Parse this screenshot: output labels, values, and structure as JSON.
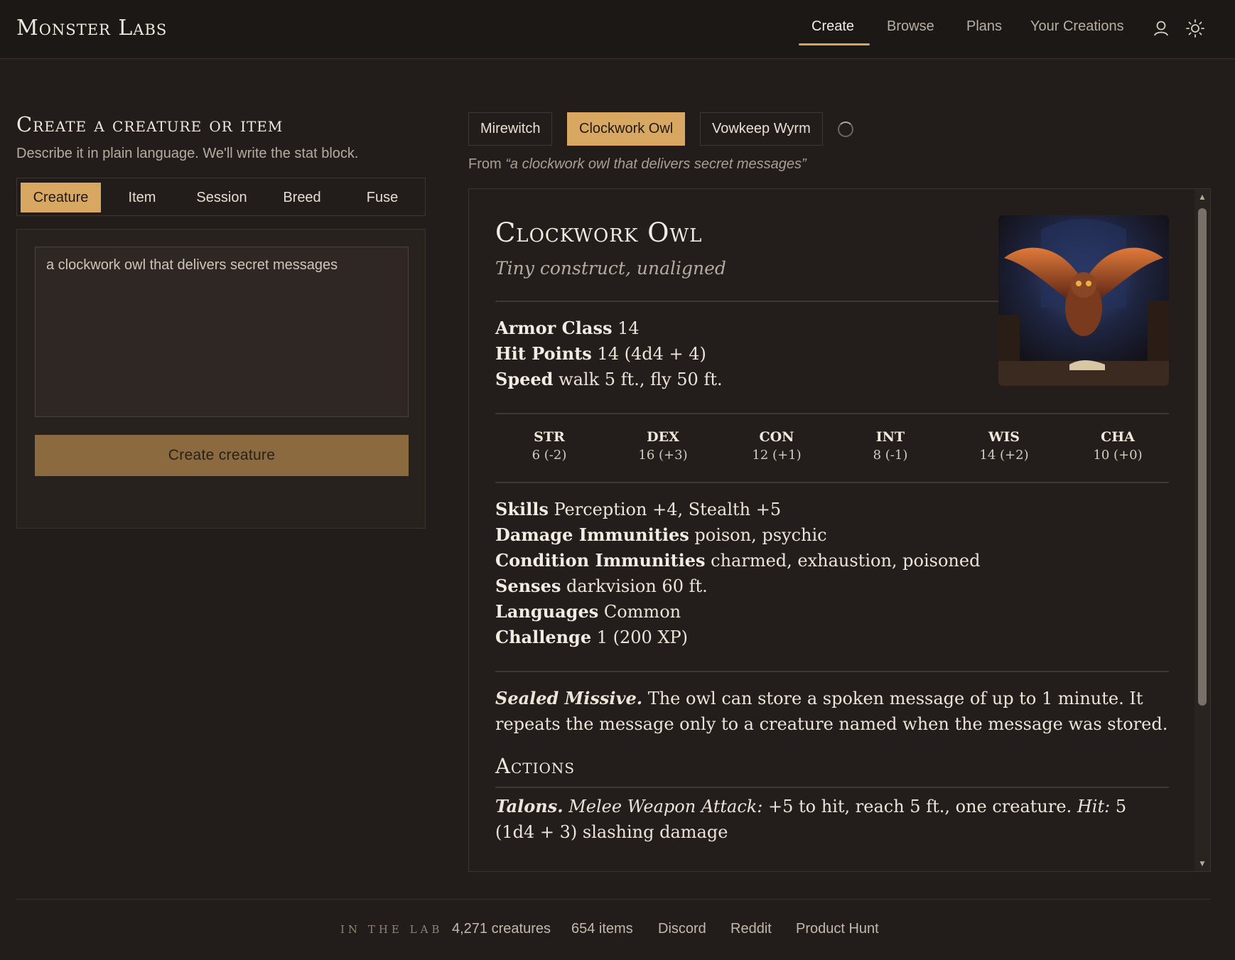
{
  "brand": "Monster Labs",
  "nav": {
    "items": [
      "Create",
      "Browse",
      "Plans",
      "Your Creations"
    ],
    "active": "Create"
  },
  "left": {
    "title": "Create a creature or item",
    "subtitle": "Describe it in plain language. We'll write the stat block.",
    "tabs": [
      "Creature",
      "Item",
      "Session",
      "Breed",
      "Fuse"
    ],
    "active_tab": "Creature",
    "prompt": "a clockwork owl that delivers secret messages",
    "button": "Create creature"
  },
  "creations": {
    "tabs": [
      "Mirewitch",
      "Clockwork Owl",
      "Vowkeep Wyrm"
    ],
    "active": "Clockwork Owl",
    "from_prefix": "From",
    "from_quote": "“a clockwork owl that delivers secret messages”"
  },
  "stat": {
    "name": "Clockwork Owl",
    "type": "Tiny construct, unaligned",
    "ac_label": "Armor Class",
    "ac": "14",
    "hp_label": "Hit Points",
    "hp": "14 (4d4 + 4)",
    "speed_label": "Speed",
    "speed": "walk 5 ft., fly 50 ft.",
    "abilities": [
      {
        "k": "STR",
        "v": "6 (-2)"
      },
      {
        "k": "DEX",
        "v": "16 (+3)"
      },
      {
        "k": "CON",
        "v": "12 (+1)"
      },
      {
        "k": "INT",
        "v": "8 (-1)"
      },
      {
        "k": "WIS",
        "v": "14 (+2)"
      },
      {
        "k": "CHA",
        "v": "10 (+0)"
      }
    ],
    "skills_label": "Skills",
    "skills": "Perception +4, Stealth +5",
    "dimm_label": "Damage Immunities",
    "dimm": "poison, psychic",
    "cimm_label": "Condition Immunities",
    "cimm": "charmed, exhaustion, poisoned",
    "senses_label": "Senses",
    "senses": "darkvision 60 ft.",
    "lang_label": "Languages",
    "lang": "Common",
    "cr_label": "Challenge",
    "cr": "1 (200 XP)",
    "trait_name": "Sealed Missive.",
    "trait_text": "The owl can store a spoken message of up to 1 minute. It repeats the message only to a creature named when the message was stored.",
    "actions_title": "Actions",
    "action_name": "Talons.",
    "action_type": "Melee Weapon Attack:",
    "action_text1": "+5 to hit, reach 5 ft., one creature.",
    "action_hit": "Hit:",
    "action_text2": "5 (1d4 + 3) slashing damage"
  },
  "footer": {
    "lab": "IN THE LAB",
    "creatures": "4,271 creatures",
    "items": "654 items",
    "links": [
      "Discord",
      "Reddit",
      "Product Hunt"
    ]
  },
  "colors": {
    "accent": "#d8a863",
    "bg": "#221d1a"
  },
  "icons": [
    "user-icon",
    "sun-icon",
    "chevron-up-icon",
    "chevron-down-icon"
  ]
}
